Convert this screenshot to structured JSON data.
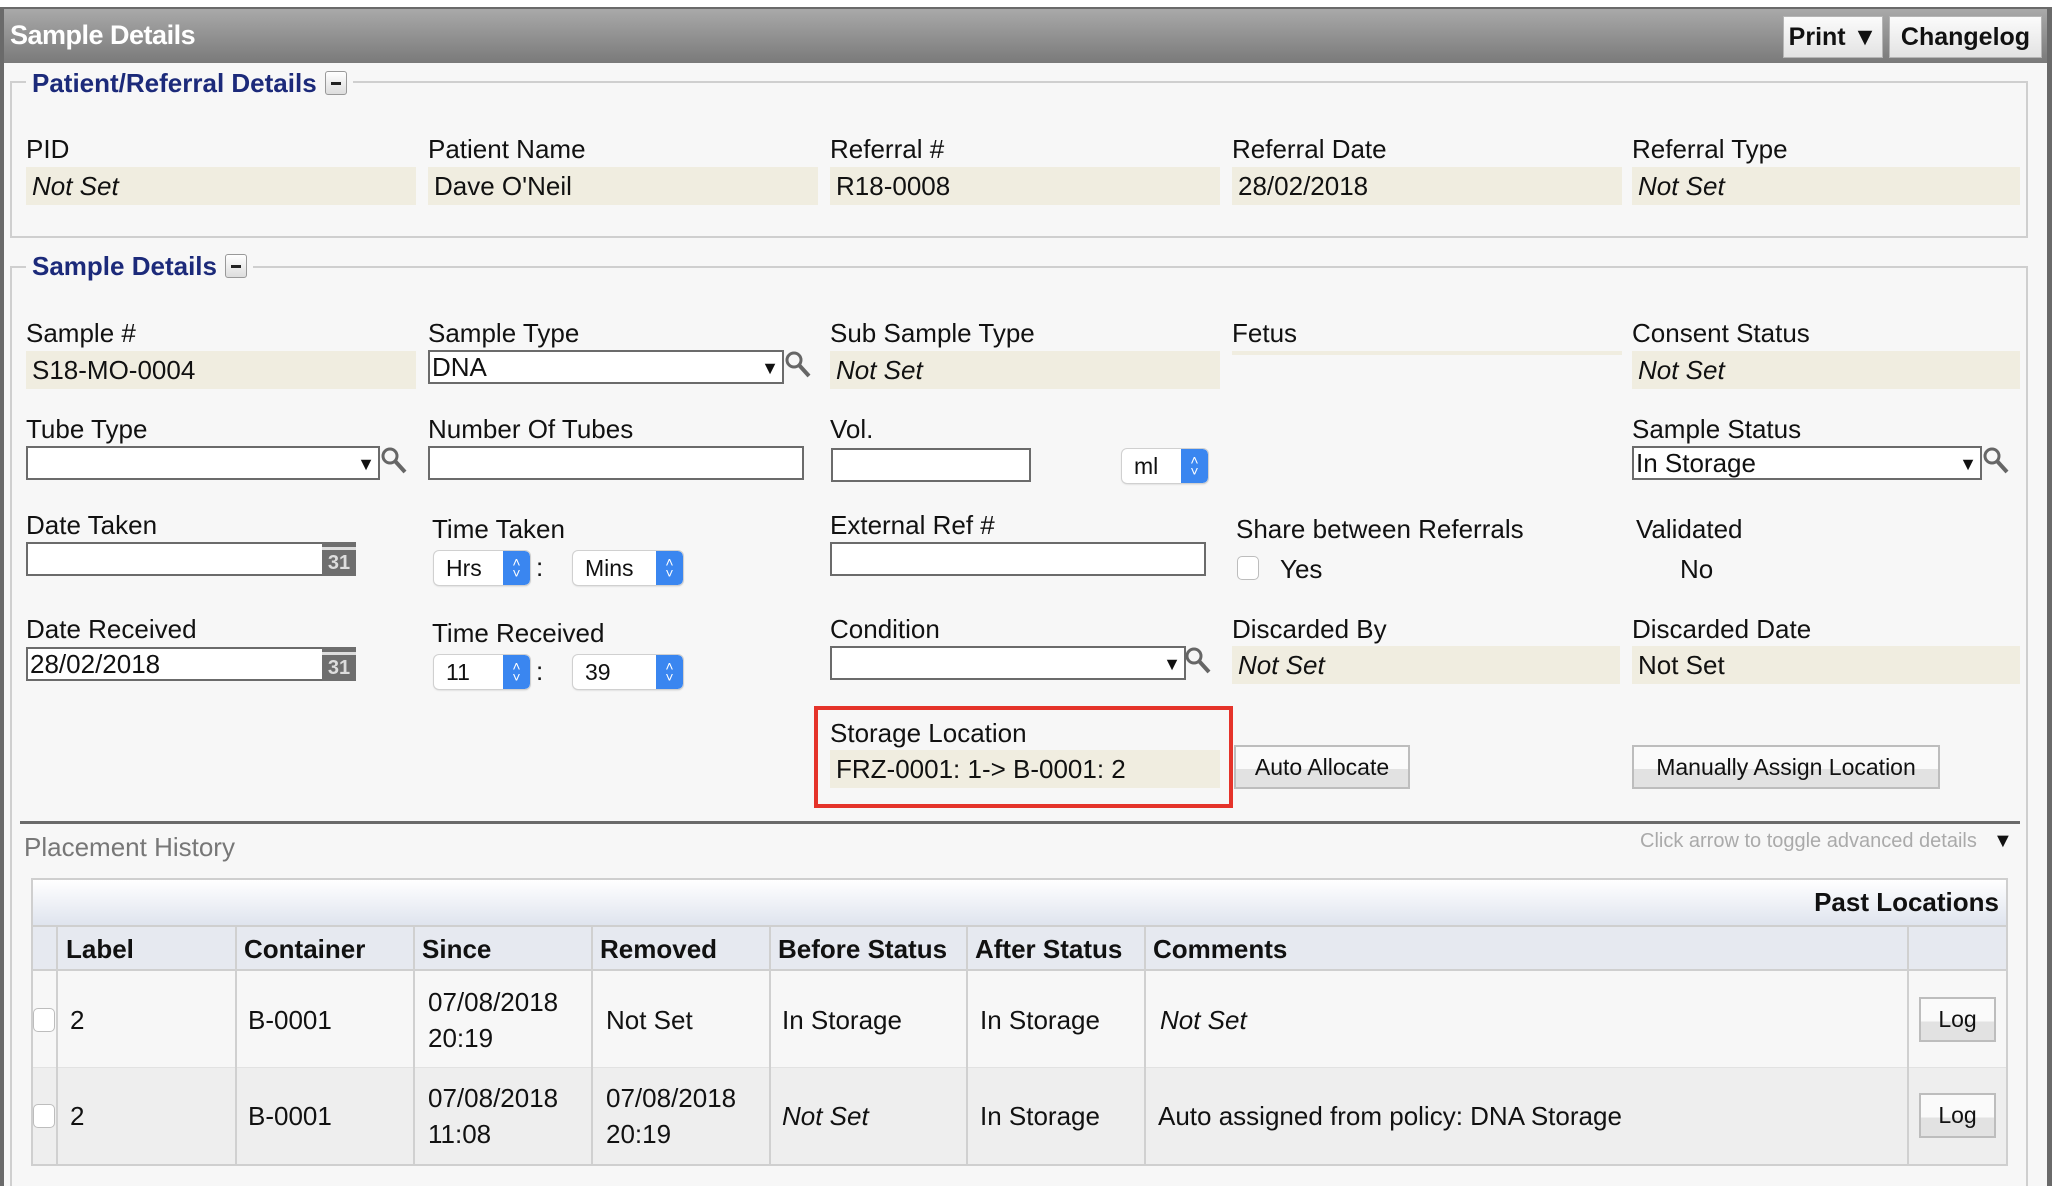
{
  "header": {
    "title": "Sample Details",
    "print_label": "Print ▼",
    "changelog_label": "Changelog"
  },
  "patient_referral": {
    "legend": "Patient/Referral Details",
    "fields": [
      {
        "label": "PID",
        "value": "Not Set"
      },
      {
        "label": "Patient Name",
        "value": "Dave O'Neil"
      },
      {
        "label": "Referral #",
        "value": "R18-0008"
      },
      {
        "label": "Referral Date",
        "value": "28/02/2018"
      },
      {
        "label": "Referral Type",
        "value": "Not Set"
      }
    ]
  },
  "sample_details": {
    "legend": "Sample Details",
    "sample_number": {
      "label": "Sample #",
      "value": "S18-MO-0004"
    },
    "sample_type": {
      "label": "Sample Type",
      "value": "DNA"
    },
    "sub_sample_type": {
      "label": "Sub Sample Type",
      "value": "Not Set"
    },
    "fetus": {
      "label": "Fetus",
      "value": ""
    },
    "consent_status": {
      "label": "Consent Status",
      "value": "Not Set"
    },
    "tube_type": {
      "label": "Tube Type",
      "value": ""
    },
    "number_of_tubes": {
      "label": "Number Of Tubes",
      "value": ""
    },
    "volume": {
      "label": "Vol.",
      "value": "",
      "unit": "ml"
    },
    "sample_status": {
      "label": "Sample Status",
      "value": "In Storage"
    },
    "date_taken": {
      "label": "Date Taken",
      "value": "",
      "calendar_day": "31"
    },
    "time_taken": {
      "label": "Time Taken",
      "hours": "Hrs",
      "minutes": "Mins",
      "separator": ":"
    },
    "external_ref": {
      "label": "External Ref #",
      "value": ""
    },
    "share_between_referrals": {
      "label": "Share between Referrals",
      "option": "Yes",
      "checked": false
    },
    "validated": {
      "label": "Validated",
      "value": "No"
    },
    "date_received": {
      "label": "Date Received",
      "value": "28/02/2018",
      "calendar_day": "31"
    },
    "time_received": {
      "label": "Time Received",
      "hours": "11",
      "minutes": "39",
      "separator": ":"
    },
    "condition": {
      "label": "Condition",
      "value": ""
    },
    "discarded_by": {
      "label": "Discarded By",
      "value": "Not Set"
    },
    "discarded_date": {
      "label": "Discarded Date",
      "value": "Not Set"
    },
    "storage_location": {
      "label": "Storage Location",
      "value": "FRZ-0001: 1-> B-0001: 2"
    },
    "auto_allocate_label": "Auto Allocate",
    "manual_assign_label": "Manually Assign Location"
  },
  "placement_history": {
    "title": "Placement History",
    "hint": "Click arrow to toggle advanced details",
    "toggle_icon": "▼",
    "table_caption": "Past Locations",
    "columns": [
      "Label",
      "Container",
      "Since",
      "Removed",
      "Before Status",
      "After Status",
      "Comments"
    ],
    "rows": [
      {
        "label": "2",
        "container": "B-0001",
        "since_date": "07/08/2018",
        "since_time": "20:19",
        "removed_date": "Not Set",
        "removed_time": "",
        "before_status": "In Storage",
        "after_status": "In Storage",
        "comments": "Not Set",
        "action": "Log"
      },
      {
        "label": "2",
        "container": "B-0001",
        "since_date": "07/08/2018",
        "since_time": "11:08",
        "removed_date": "07/08/2018",
        "removed_time": "20:19",
        "before_status": "Not Set",
        "after_status": "In Storage",
        "comments": "Auto assigned from policy: DNA Storage",
        "action": "Log"
      }
    ]
  }
}
